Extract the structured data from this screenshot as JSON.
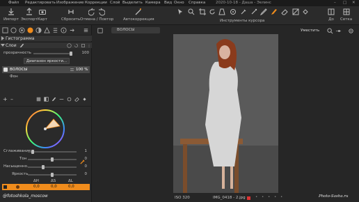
{
  "menu": {
    "items": [
      "Файл",
      "Редактировать",
      "Изображение",
      "Коррекции",
      "Слой",
      "Выделить",
      "Камера",
      "Вид",
      "Окно",
      "Справка"
    ],
    "title": "2020-10-18 - Даша - Эелинс"
  },
  "toolbar": {
    "import": "Импорт",
    "export": "Экспорт",
    "card": "Карт",
    "reset": "Сбросить",
    "undo_redo": "Отмена / Повтор",
    "autocorrect": "Автокоррекция",
    "cursor_tools": "Инструменты курсора",
    "to": "До",
    "grid": "Сетка"
  },
  "left": {
    "histogram": "Гистограмма",
    "layers": "Слои",
    "opacity_label": "прозрачность",
    "opacity_value": "100",
    "brightness_range": "Диапазон яркости...",
    "layers_list": [
      {
        "name": "ВОЛОСЫ",
        "value": "100 %",
        "checked": true
      },
      {
        "name": "Фон",
        "value": "",
        "checked": false
      }
    ],
    "sliders": [
      {
        "label": "Сглаживание",
        "value": "1"
      },
      {
        "label": "Тон",
        "value": "0"
      },
      {
        "label": "Насыщенно...",
        "value": "0"
      },
      {
        "label": "Яркость",
        "value": "0"
      }
    ],
    "hsl_headers": [
      "ΔH",
      "ΔS",
      "ΔL"
    ],
    "hsl_values": [
      "0,0",
      "0,0",
      "0,0"
    ]
  },
  "canvas": {
    "layer_selector": "ВОЛОСЫ",
    "zoom_label": "Уместить",
    "iso": "ISO 320",
    "filename": "IMG_0418 - 2.jpg",
    "watermark": "Photo-Sasha.ru",
    "watermark2": "@fotoshkola_moscow"
  },
  "colors": {
    "accent": "#f08c1c",
    "bar_bg": "#1b1b1b",
    "panel_bg": "#2a2a2a",
    "canvas_bg": "#262626"
  }
}
